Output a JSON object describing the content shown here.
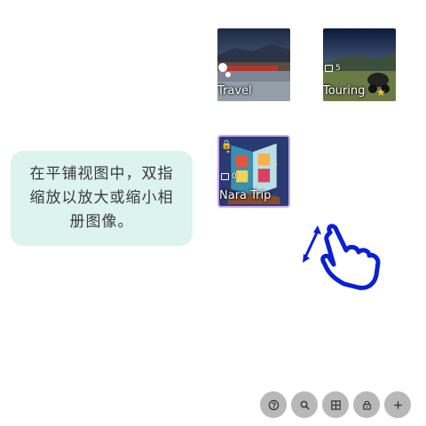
{
  "albums": [
    {
      "title": "Travel",
      "count": "",
      "locked": false
    },
    {
      "title": "Touring",
      "count": "5",
      "locked": false
    },
    {
      "title": "Nara Trip",
      "count": "0",
      "locked": true
    }
  ],
  "tip": {
    "text": "在平铺视图中，双指缩放以放大或缩小相册图像。"
  },
  "toolbar": {
    "buttons": [
      "help-icon",
      "search-icon",
      "grid-icon",
      "lock-icon",
      "plus-icon"
    ]
  },
  "colors": {
    "tip_background": "#dcf3ee",
    "gesture_blue": "#0a1fd6",
    "toolbar_button": "#b8b8b8",
    "nara_border": "#c8a8f0"
  }
}
